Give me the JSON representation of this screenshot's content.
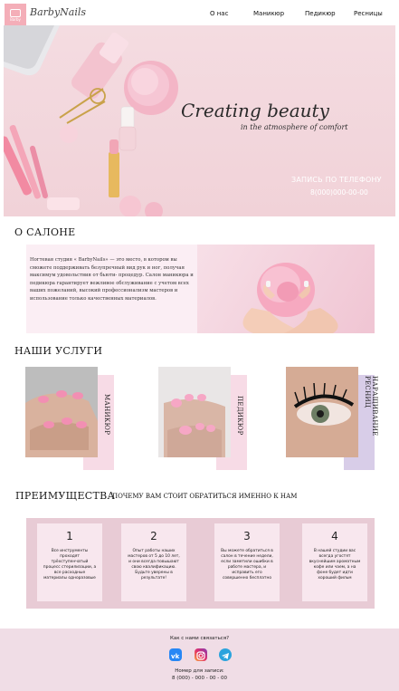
{
  "header": {
    "logo_text": "Barby",
    "brand": "BarbyNails",
    "nav": [
      "О нас",
      "Маникюр",
      "Педикюр",
      "Ресницы"
    ]
  },
  "hero": {
    "title": "Creating beauty",
    "subtitle": "in the atmosphere of comfort",
    "phone_label": "ЗАПИСЬ ПО ТЕЛЕФОНУ",
    "phone": "8(000)000-00-00"
  },
  "about": {
    "title": "О САЛОНЕ",
    "text": "Ногтевая студия « BarbyNails» — это место, в котором вы сможете поддерживать безупречный вид рук и ног, получая максимум удовольствия от бьюти- процедур. Салон маникюра и педикюра гарантирует вежливое обслуживание с учетом всех ваших пожеланий, высокий профессионализм мастеров и использование только качественных материалов."
  },
  "services": {
    "title": "НАШИ УСЛУГИ",
    "items": [
      {
        "label": "МАНИКЮР"
      },
      {
        "label": "ПЕДИКЮР"
      },
      {
        "label": "НАРАЩИВАНИЕ РЕСНИЦ"
      }
    ]
  },
  "advantages": {
    "title": "ПРЕИМУЩЕСТВА",
    "subtitle": "ПОЧЕМУ ВАМ СТОИТ ОБРАТИТЬСЯ ИМЕННО К НАМ",
    "cards": [
      {
        "num": "1",
        "text": "Все инструменты проходят трёхступенчатый процесс стерилизации, а все расходные материалы одноразовые"
      },
      {
        "num": "2",
        "text": "Опыт работы наших мастеров от 5 до 10 лет, и они всегда повышают свою квалификацию. Будьте уверены в результате!"
      },
      {
        "num": "3",
        "text": "Вы можете обратиться в салон в течение недели, если заметили ошибки в работе мастера, и исправить его совершенно бесплатно"
      },
      {
        "num": "4",
        "text": "В нашей студии вас всегда угостят вкуснейшим ароматным кофе или чаем, а на фоне будет идти хороший фильм"
      }
    ]
  },
  "footer": {
    "question": "Как с нами связаться?",
    "icons": [
      "vk-icon",
      "instagram-icon",
      "telegram-icon"
    ],
    "booking_label": "Номер для записи:",
    "phone": "8 (000) - 000 - 00 - 00"
  },
  "colors": {
    "accent_pink": "#f4aeb8",
    "soft_pink": "#fbeef4",
    "lilac": "#e8cbd5",
    "vk": "#2787f5",
    "telegram": "#2aa3dd"
  }
}
